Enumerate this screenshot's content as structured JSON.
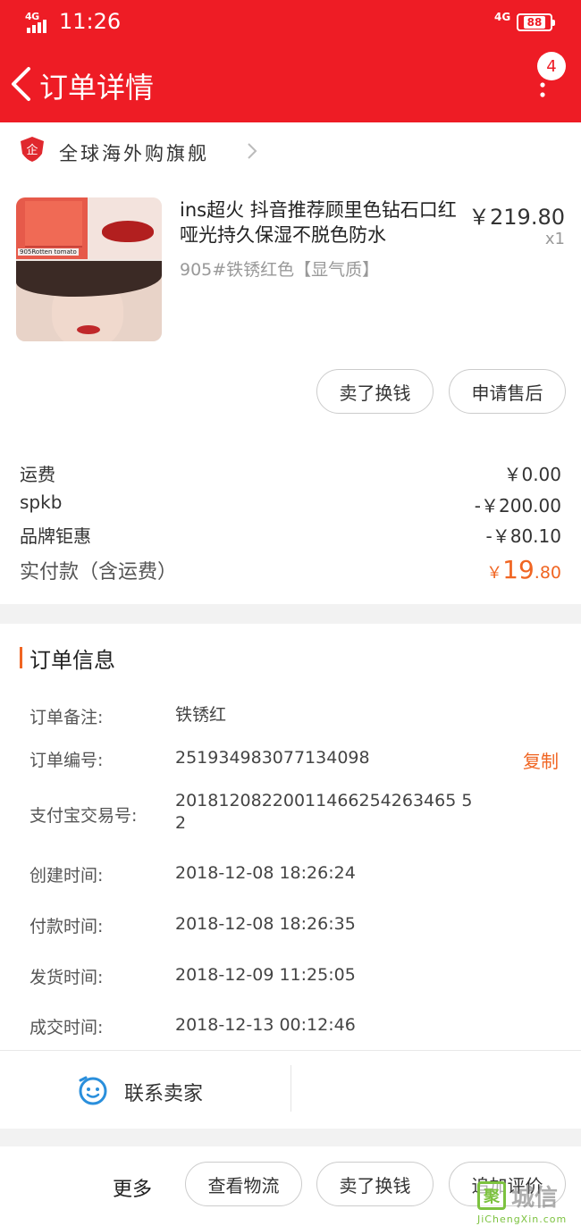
{
  "status_bar": {
    "network": "4G",
    "time": "11:26",
    "right_network": "4G",
    "battery": "88"
  },
  "header": {
    "title": "订单详情",
    "badge_count": "4"
  },
  "store": {
    "icon_char": "企",
    "name": "全球海外购旗舰"
  },
  "product": {
    "title": "ins超火 抖音推荐顾里色钻石口红 哑光持久保湿不脱色防水",
    "sku": "905#铁锈红色【显气质】",
    "price": "￥219.80",
    "qty": "x1",
    "thumb_text": "905Rotten tomato"
  },
  "actions": {
    "sell": "卖了换钱",
    "after_sale": "申请售后"
  },
  "fees": [
    {
      "label": "运费",
      "value": "￥0.00"
    },
    {
      "label": "spkb",
      "value": "-￥200.00"
    },
    {
      "label": "品牌钜惠",
      "value": "-￥80.10"
    }
  ],
  "total": {
    "label": "实付款（含运费）",
    "symbol": "￥",
    "int": "19",
    "dec": ".80"
  },
  "order_info": {
    "title": "订单信息",
    "rows": [
      {
        "label": "订单备注:",
        "value": "铁锈红"
      },
      {
        "label": "订单编号:",
        "value": "251934983077134098"
      },
      {
        "label": "支付宝交易号:",
        "value": "20181208220011466254263465 5\n2"
      },
      {
        "label": "创建时间:",
        "value": "2018-12-08 18:26:24"
      },
      {
        "label": "付款时间:",
        "value": "2018-12-08 18:26:35"
      },
      {
        "label": "发货时间:",
        "value": "2018-12-09 11:25:05"
      },
      {
        "label": "成交时间:",
        "value": "2018-12-13 00:12:46"
      }
    ],
    "copy_label": "复制",
    "contact_label": "联系卖家"
  },
  "bottom_bar": {
    "more": "更多",
    "logistics": "查看物流",
    "sell": "卖了换钱",
    "review": "追加评价"
  },
  "watermark": {
    "logo_char": "聚",
    "cn": "城信",
    "url": "JiChengXin.com"
  },
  "colors": {
    "brand_red": "#ee1c25",
    "accent_orange": "#f06522"
  }
}
